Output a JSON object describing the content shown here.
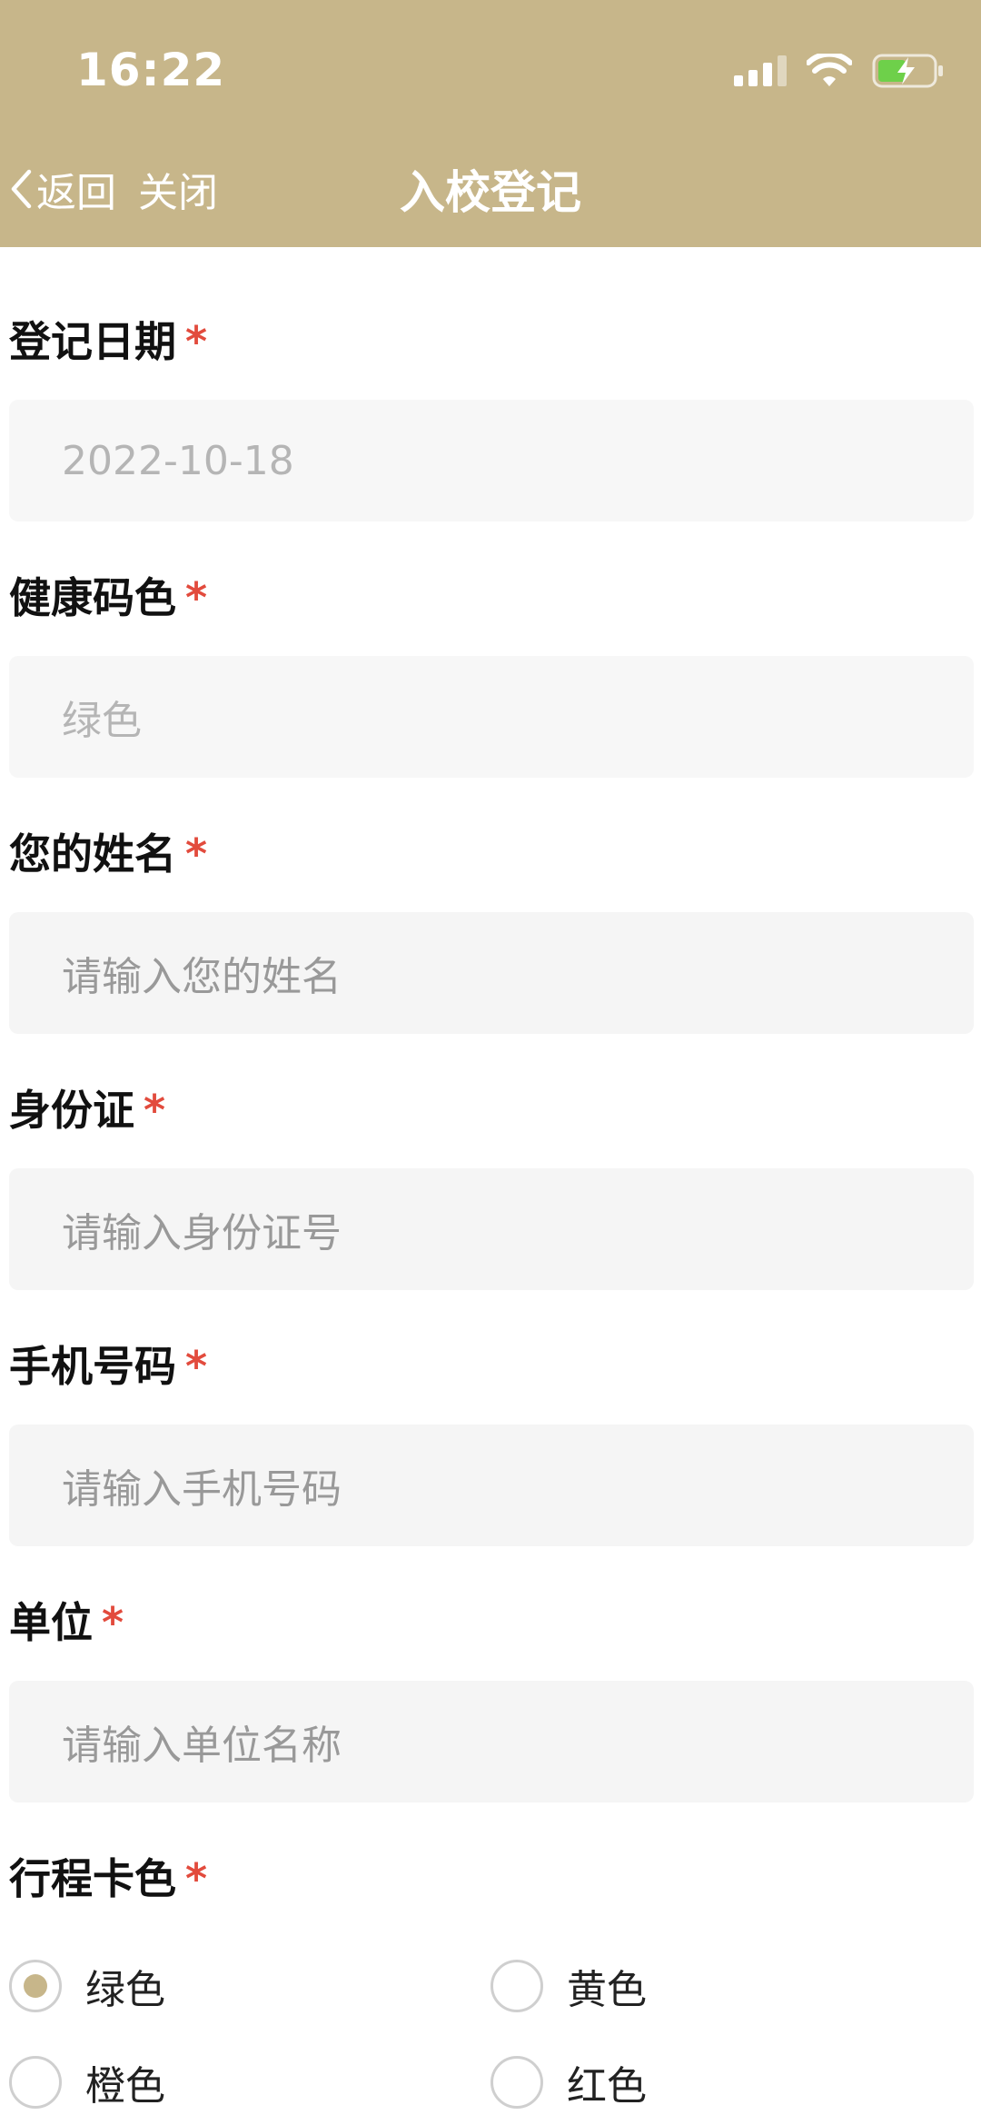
{
  "status_bar": {
    "time": "16:22",
    "icons": [
      "signal-icon",
      "wifi-icon",
      "battery-charging-icon"
    ],
    "battery_color": "#6ed04a"
  },
  "nav": {
    "back_label": "返回",
    "close_label": "关闭",
    "title": "入校登记"
  },
  "colors": {
    "header_bg": "#c7b68a",
    "required": "#e24b3d",
    "input_bg": "#f5f5f5",
    "radio_checked": "#c7b68a"
  },
  "form": {
    "required_mark": "*",
    "fields": [
      {
        "label": "登记日期",
        "value": "2022-10-18",
        "disabled": true
      },
      {
        "label": "健康码色",
        "value": "绿色",
        "disabled": true
      },
      {
        "label": "您的姓名",
        "placeholder": "请输入您的姓名"
      },
      {
        "label": "身份证",
        "placeholder": "请输入身份证号"
      },
      {
        "label": "手机号码",
        "placeholder": "请输入手机号码"
      },
      {
        "label": "单位",
        "placeholder": "请输入单位名称"
      }
    ],
    "trip_card": {
      "label": "行程卡色",
      "options": [
        {
          "label": "绿色",
          "checked": true
        },
        {
          "label": "黄色",
          "checked": false
        },
        {
          "label": "橙色",
          "checked": false
        },
        {
          "label": "红色",
          "checked": false
        }
      ]
    }
  }
}
